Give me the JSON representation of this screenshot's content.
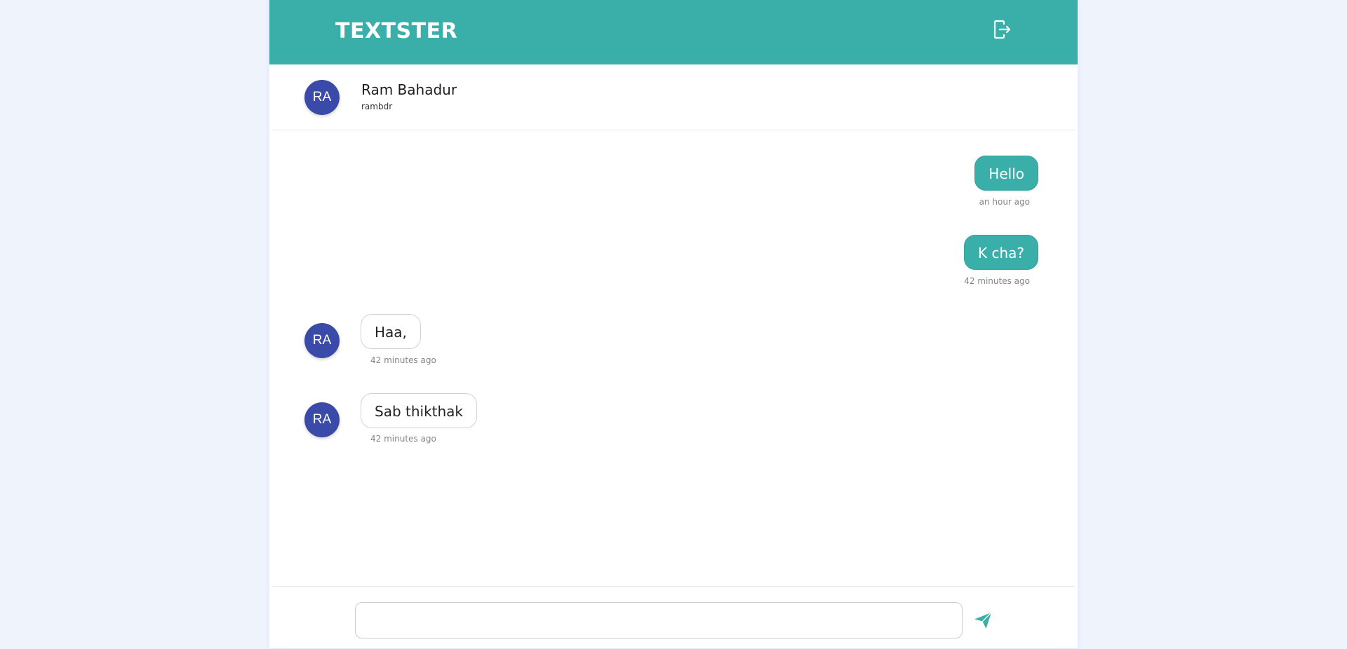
{
  "app": {
    "brand": "TEXTSTER",
    "accent_color": "#3aafa9",
    "avatar_color": "#3a4aa8",
    "logout_icon": "logout-icon"
  },
  "contact": {
    "initials": "RA",
    "name": "Ram Bahadur",
    "username": "rambdr"
  },
  "messages": [
    {
      "direction": "sent",
      "text": "Hello",
      "time": "an hour ago"
    },
    {
      "direction": "sent",
      "text": "K cha?",
      "time": "42 minutes ago"
    },
    {
      "direction": "received",
      "initials": "RA",
      "text": "Haa,",
      "time": "42 minutes ago"
    },
    {
      "direction": "received",
      "initials": "RA",
      "text": "Sab thikthak",
      "time": "42 minutes ago"
    }
  ],
  "composer": {
    "value": "",
    "placeholder": "",
    "send_icon": "send-icon"
  }
}
